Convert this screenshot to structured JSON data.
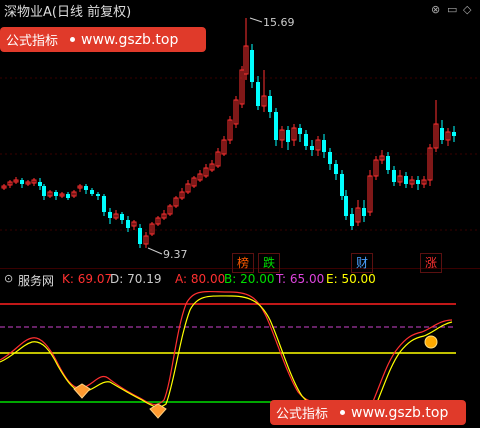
{
  "title": "深物业A(日线 前复权)",
  "window_controls": {
    "close": "⊗",
    "min": "▭",
    "max": "◇"
  },
  "watermark": {
    "label": "公式指标",
    "url": "www.gszb.top"
  },
  "price_annotations": {
    "high": "15.69",
    "low": "9.37"
  },
  "signals": [
    {
      "text": "榜",
      "color": "#ff5a00"
    },
    {
      "text": "跌",
      "color": "#00dd00"
    },
    {
      "text": "财",
      "color": "#4aa0ff"
    },
    {
      "text": "涨",
      "color": "#ff3030"
    }
  ],
  "indicator": {
    "name": "服务网",
    "values": [
      {
        "label": "K:",
        "value": "69.07",
        "color": "#ff3030"
      },
      {
        "label": "D:",
        "value": "70.19",
        "color": "#cccccc"
      },
      {
        "label": "A:",
        "value": "80.00",
        "color": "#ff3030"
      },
      {
        "label": "B:",
        "value": "20.00",
        "color": "#00dd00"
      },
      {
        "label": "T:",
        "value": "65.00",
        "color": "#dd44dd"
      },
      {
        "label": "E:",
        "value": "50.00",
        "color": "#ffff00"
      }
    ]
  },
  "chart_data": {
    "type": "candlestick",
    "price_high": 15.69,
    "price_low": 9.37,
    "reference_lines": [
      {
        "name": "A",
        "value": 80,
        "color": "#ff2020"
      },
      {
        "name": "T",
        "value": 65,
        "color": "#cc44cc"
      },
      {
        "name": "E",
        "value": 50,
        "color": "#ffff00"
      },
      {
        "name": "B",
        "value": 20,
        "color": "#00dd00"
      }
    ]
  }
}
